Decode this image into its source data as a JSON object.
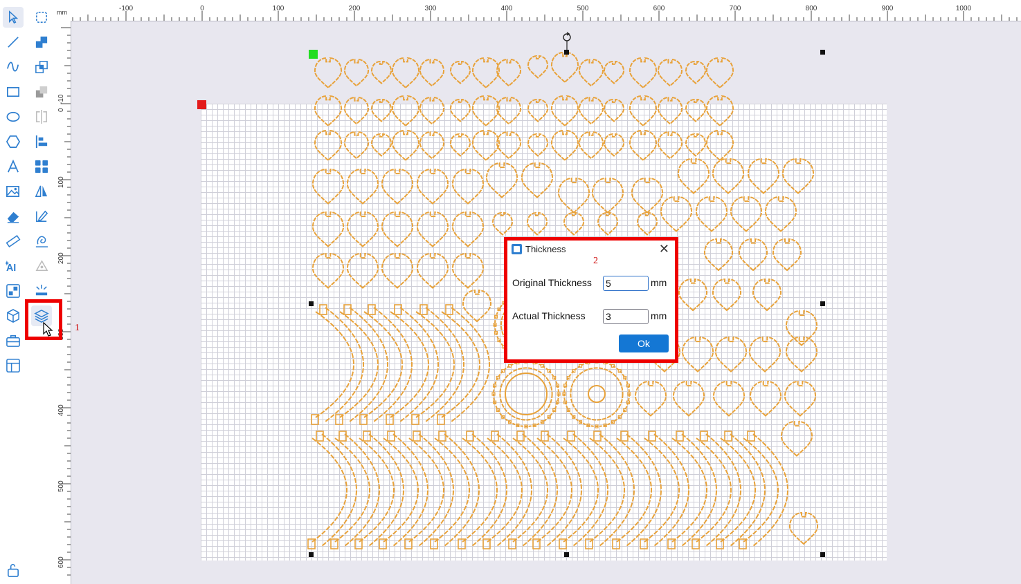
{
  "ruler": {
    "unit": "mm",
    "top_ticks": [
      "-100",
      "0",
      "100",
      "200",
      "300",
      "400",
      "500",
      "600",
      "700",
      "800",
      "900",
      "1000"
    ],
    "left_ticks": [
      "-10",
      "0",
      "100",
      "200",
      "300",
      "400",
      "500",
      "600"
    ]
  },
  "toolbar": {
    "left_column": [
      "select-arrow",
      "line",
      "curve",
      "rectangle",
      "ellipse",
      "polygon",
      "text",
      "image",
      "eraser",
      "measure",
      "ai-text",
      "array",
      "cube",
      "toolbox",
      "layout",
      "unlock"
    ],
    "right_column": [
      "node-edit",
      "union",
      "intersect",
      "subtract",
      "split",
      "align",
      "group-grid",
      "mirror",
      "edit-path",
      "weld",
      "pen-tool",
      "explode",
      "thickness-layers"
    ],
    "active_tool": "thickness-layers"
  },
  "annotations": {
    "step1": "1",
    "step2": "2"
  },
  "colors": {
    "shape_stroke": "#e8a23a",
    "highlight": "#ee0000",
    "accent": "#1477d4",
    "origin_marker": "#e31b1b",
    "selection_marker": "#22dd22"
  },
  "dialog": {
    "title": "Thickness",
    "close_symbol": "✕",
    "original_label": "Original Thickness",
    "original_value": "5",
    "actual_label": "Actual Thickness",
    "actual_value": "3",
    "unit": "mm",
    "ok_label": "Ok"
  }
}
